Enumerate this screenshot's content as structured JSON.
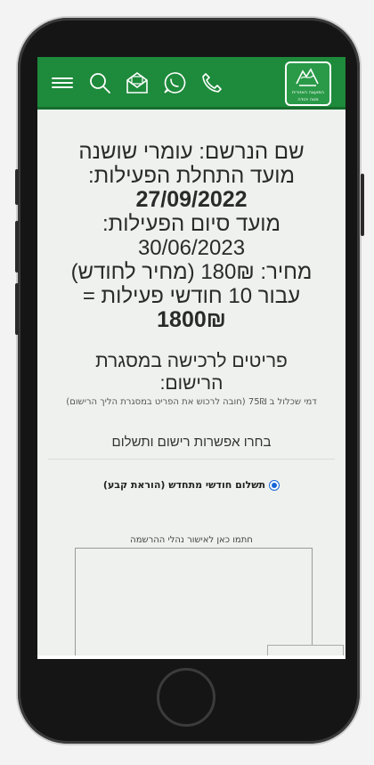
{
  "header": {
    "icons": [
      "menu-icon",
      "search-icon",
      "mail-icon",
      "whatsapp-icon",
      "phone-icon"
    ],
    "logo_text_line1": "המועצה האזורית",
    "logo_text_line2": "מטה יהודה"
  },
  "registration": {
    "line1": "שם הנרשם: עומרי שושנה",
    "line2": "מועד התחלת הפעילות:",
    "line3": "27/09/2022",
    "line4": "מועד סיום הפעילות:",
    "line5": "30/06/2023",
    "line6": "מחיר: 180₪ (מחיר לחודש)",
    "line7": "עבור 10 חודשי פעילות =",
    "line8": "1800₪"
  },
  "items": {
    "title_line1": "פריטים לרכישה במסגרת",
    "title_line2": "הרישום:",
    "note": "דמי שכלול ב 75₪ (חובה לרכוש את הפריט במסגרת הליך הרישום)"
  },
  "payment": {
    "choose_label": "בחרו אפשרות רישום ותשלום",
    "option_label": "תשלום חודשי מתחדש (הוראת קבע)"
  },
  "signature": {
    "label": "חתמו כאן לאישור נהלי ההרשמה"
  },
  "colors": {
    "header_green": "#1e8a3b",
    "radio_blue": "#1565d8"
  }
}
